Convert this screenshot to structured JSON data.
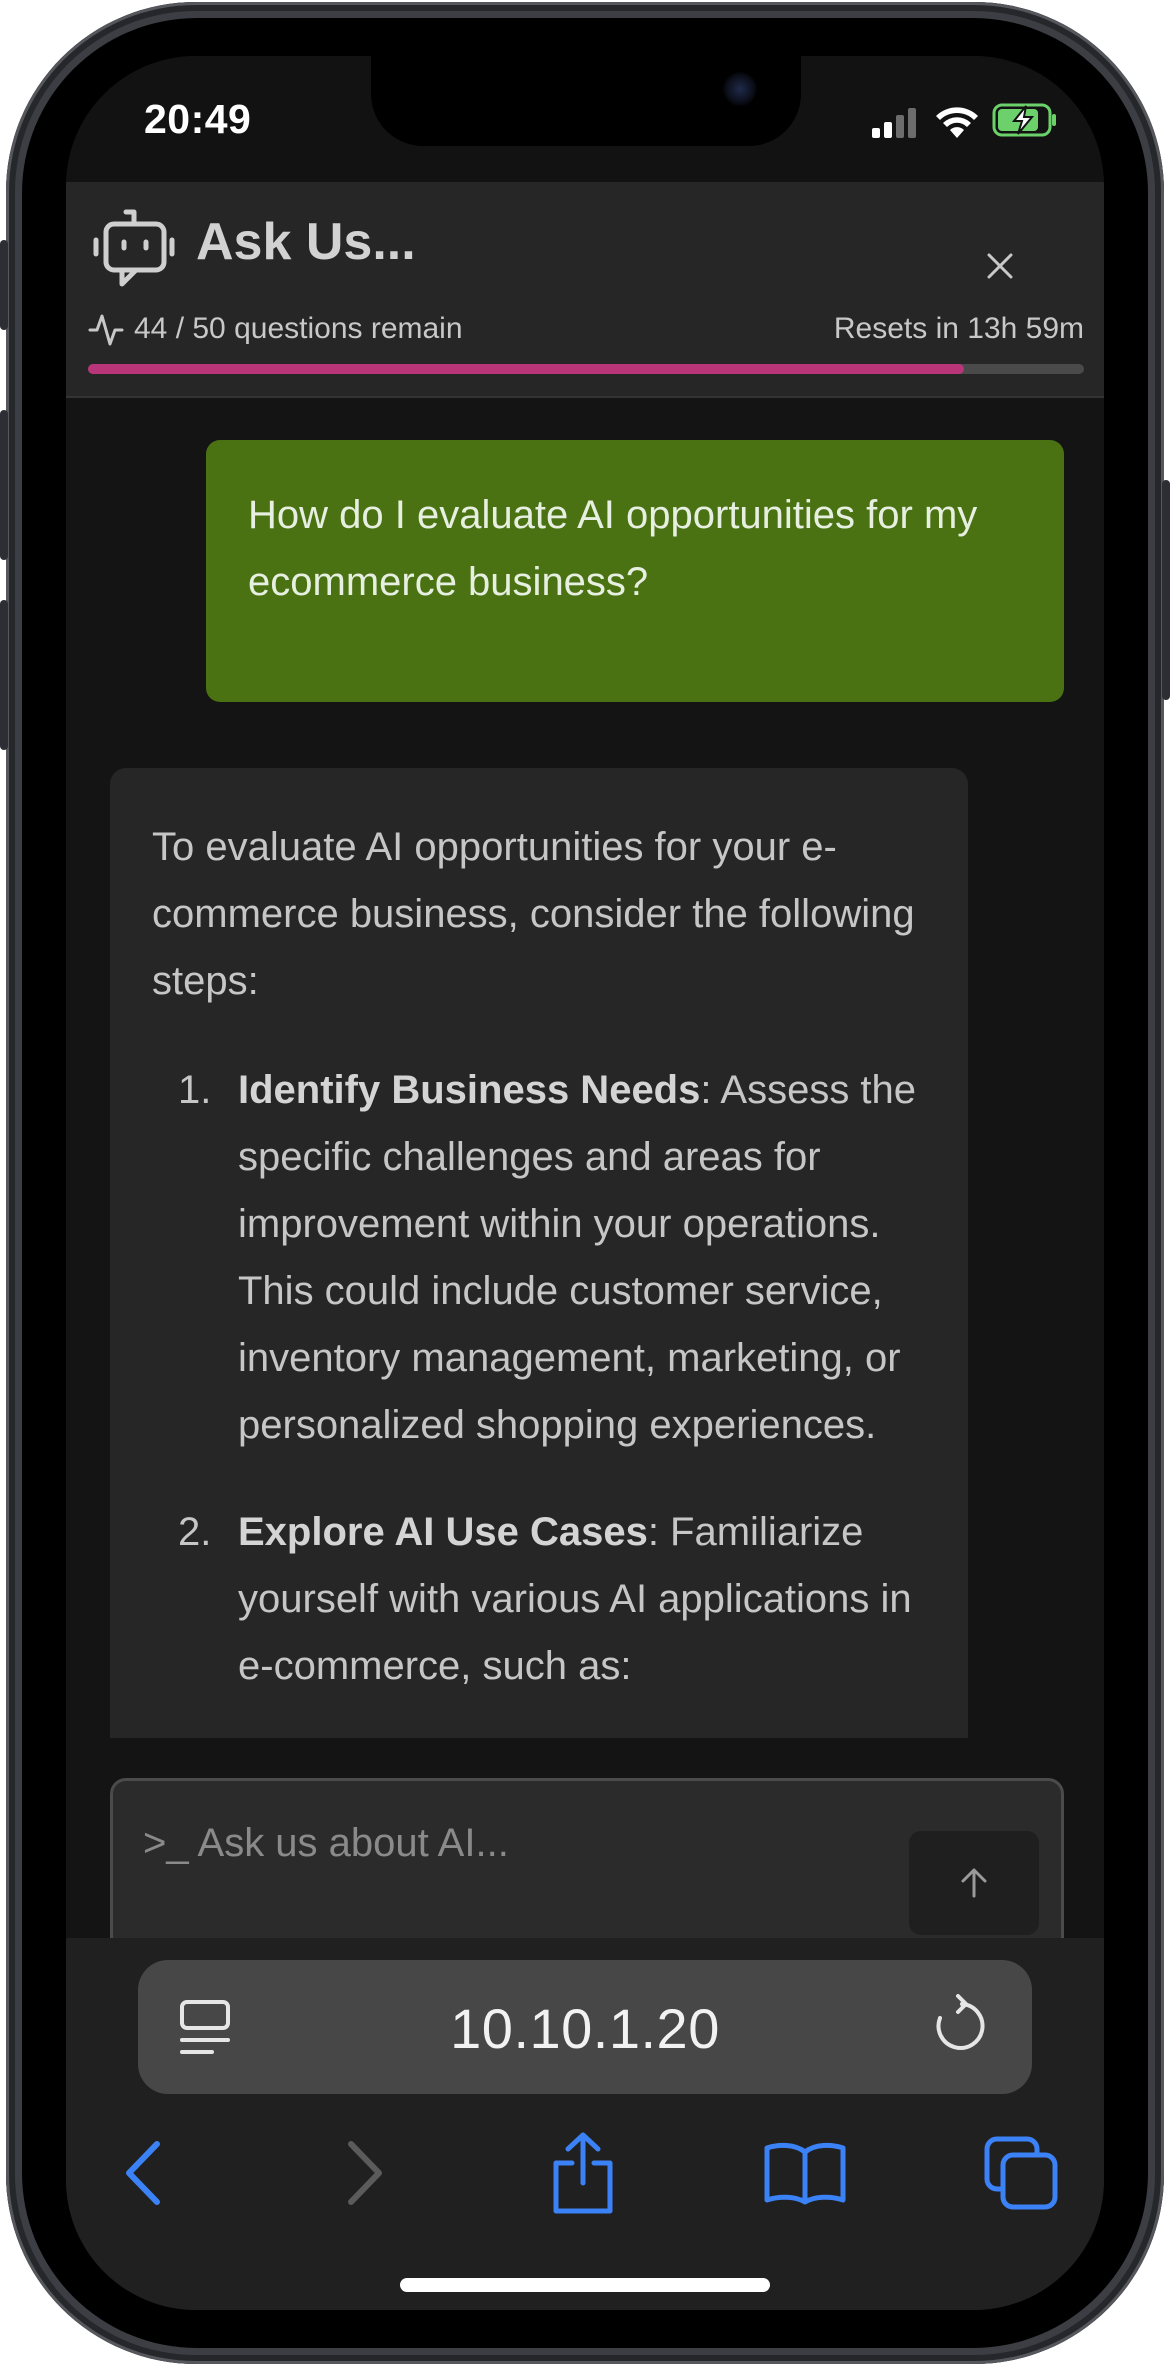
{
  "status_bar": {
    "time": "20:49"
  },
  "chat": {
    "title": "Ask Us...",
    "quota_text": "44 / 50 questions remain",
    "quota_used": 44,
    "quota_total": 50,
    "reset_text": "Resets in 13h 59m",
    "progress_color": "#b8357a"
  },
  "messages": {
    "user_message": "How do I evaluate AI opportunities for my ecommerce business?",
    "bot_intro": "To evaluate AI opportunities for your e-commerce business, consider the following steps:",
    "steps": [
      {
        "num": "1.",
        "title": "Identify Business Needs",
        "text": ": Assess the specific challenges and areas for improvement within your operations. This could include customer service, inventory management, marketing, or personalized shopping experiences."
      },
      {
        "num": "2.",
        "title": "Explore AI Use Cases",
        "text": ": Familiarize yourself with various AI applications in e-commerce, such as:"
      }
    ]
  },
  "input": {
    "placeholder": ">_ Ask us about AI..."
  },
  "browser": {
    "url": "10.10.1.20"
  },
  "colors": {
    "user_bubble": "#4a7213",
    "bot_bubble": "#262626",
    "accent_blue": "#3b82f6"
  }
}
